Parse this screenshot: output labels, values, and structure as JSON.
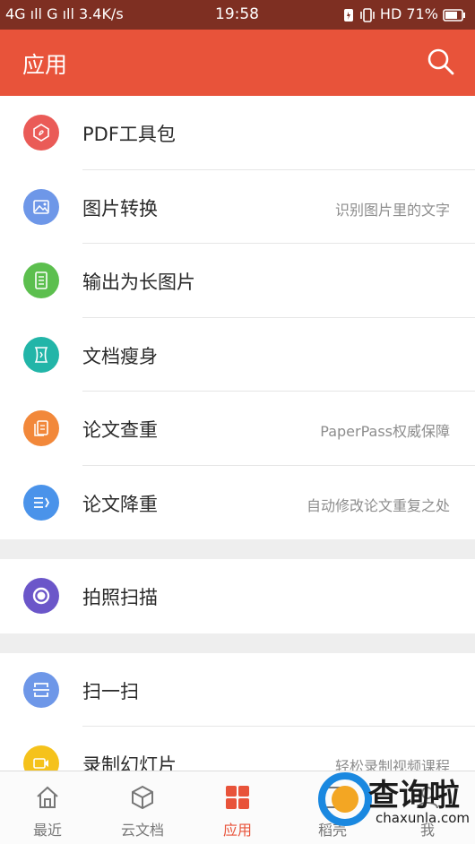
{
  "status_bar": {
    "left": "4G ıll G ıll 3.4K/s",
    "time": "19:58",
    "right": "HD 71%"
  },
  "header": {
    "title": "应用",
    "search_icon": "search-icon"
  },
  "colors": {
    "brand": "#e8533a",
    "status_bar": "#7e2f22"
  },
  "sections": [
    {
      "items": [
        {
          "label": "PDF工具包",
          "hint": "",
          "icon": "pdf-icon",
          "color": "#ea5b57"
        },
        {
          "label": "图片转换",
          "hint": "识别图片里的文字",
          "icon": "image-icon",
          "color": "#6e97e8"
        },
        {
          "label": "输出为长图片",
          "hint": "",
          "icon": "long-image-icon",
          "color": "#5cbf4e"
        },
        {
          "label": "文档瘦身",
          "hint": "",
          "icon": "document-slim-icon",
          "color": "#22b5a8"
        },
        {
          "label": "论文查重",
          "hint": "PaperPass权威保障",
          "icon": "paper-check-icon",
          "color": "#f2883a"
        },
        {
          "label": "论文降重",
          "hint": "自动修改论文重复之处",
          "icon": "paper-rewrite-icon",
          "color": "#4a93ea"
        }
      ]
    },
    {
      "items": [
        {
          "label": "拍照扫描",
          "hint": "",
          "icon": "camera-scan-icon",
          "color": "#6b56c9"
        }
      ]
    },
    {
      "items": [
        {
          "label": "扫一扫",
          "hint": "",
          "icon": "scan-icon",
          "color": "#6e97e8"
        },
        {
          "label": "录制幻灯片",
          "hint": "轻松录制视频课程",
          "icon": "record-slides-icon",
          "color": "#f5c21b"
        }
      ]
    }
  ],
  "bottom_nav": [
    {
      "label": "最近",
      "icon": "home-icon",
      "active": false
    },
    {
      "label": "云文档",
      "icon": "cube-icon",
      "active": false
    },
    {
      "label": "应用",
      "icon": "apps-grid-icon",
      "active": true
    },
    {
      "label": "稻壳",
      "icon": "docer-icon",
      "active": false
    },
    {
      "label": "我",
      "icon": "profile-icon",
      "active": false
    }
  ],
  "watermark": {
    "cn": "查询啦",
    "en": "chaxunla.com"
  }
}
